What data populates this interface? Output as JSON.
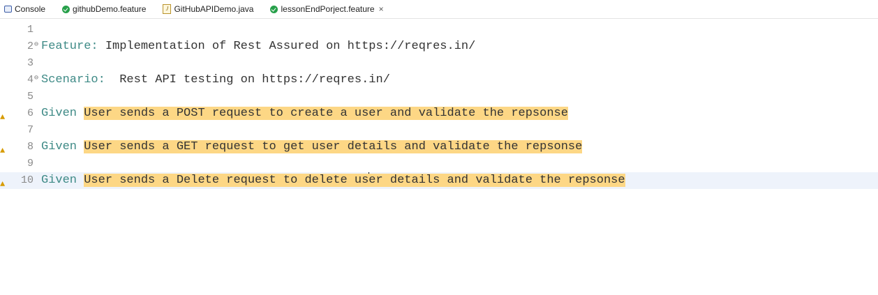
{
  "tabs": [
    {
      "label": "Console",
      "icon": "console-icon"
    },
    {
      "label": "githubDemo.feature",
      "icon": "feature-file-icon"
    },
    {
      "label": "GitHubAPIDemo.java",
      "icon": "java-file-icon"
    },
    {
      "label": "lessonEndPorject.feature",
      "icon": "feature-file-icon",
      "active": true,
      "close": "×"
    }
  ],
  "editor": {
    "lines": [
      {
        "num": "1",
        "keyword": "",
        "text": "",
        "highlight": ""
      },
      {
        "num": "2",
        "keyword": "Feature:",
        "text": " Implementation of Rest Assured on https://reqres.in/",
        "highlight": "",
        "fold": "⊖"
      },
      {
        "num": "3",
        "keyword": "",
        "text": "",
        "highlight": ""
      },
      {
        "num": "4",
        "keyword": "Scenario:",
        "text": "  Rest API testing on https://reqres.in/",
        "highlight": "",
        "fold": "⊖"
      },
      {
        "num": "5",
        "keyword": "",
        "text": "",
        "highlight": ""
      },
      {
        "num": "6",
        "keyword": "Given",
        "text": " ",
        "highlight": "User sends a POST request to create a user and validate the repsonse",
        "warning": true
      },
      {
        "num": "7",
        "keyword": "",
        "text": "",
        "highlight": ""
      },
      {
        "num": "8",
        "keyword": "Given",
        "text": " ",
        "highlight": "User sends a GET request to get user details and validate the repsonse",
        "warning": true
      },
      {
        "num": "9",
        "keyword": "",
        "text": "",
        "highlight": ""
      },
      {
        "num": "10",
        "keyword": "Given",
        "text": " ",
        "highlight_before_caret": "User sends a Delete request to delete us",
        "highlight_after_caret": "er details and validate the repsonse",
        "warning": true,
        "current": true
      }
    ]
  },
  "colors": {
    "keyword": "#3e8a86",
    "highlight": "#fdd785",
    "line_number": "#8a8a8a",
    "warning": "#d79b00",
    "current_line": "#eef3fb"
  }
}
